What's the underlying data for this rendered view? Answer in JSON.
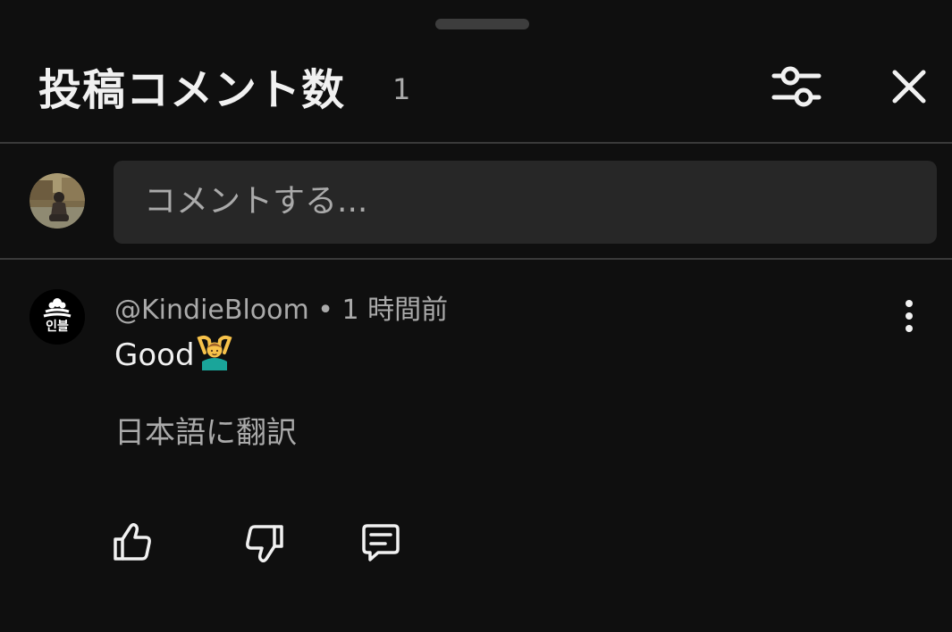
{
  "header": {
    "title": "投稿コメント数",
    "count": "1"
  },
  "composer": {
    "placeholder": "コメントする..."
  },
  "comments": [
    {
      "handle": "@KindieBloom",
      "separator": " • ",
      "time": "1 時間前",
      "text": "Good",
      "emoji": "person-gesturing-ok",
      "translate_label": "日本語に翻訳",
      "avatar_badge": "인블"
    }
  ],
  "icons": {
    "filter": "sliders-icon",
    "close": "close-icon",
    "more": "more-vertical-icon",
    "like": "thumbs-up-icon",
    "dislike": "thumbs-down-icon",
    "reply": "reply-icon"
  },
  "colors": {
    "background": "#0f0f0f",
    "input_background": "#272727",
    "primary_text": "#f1f1f1",
    "secondary_text": "#aaaaaa",
    "divider": "#3a3a3a"
  }
}
